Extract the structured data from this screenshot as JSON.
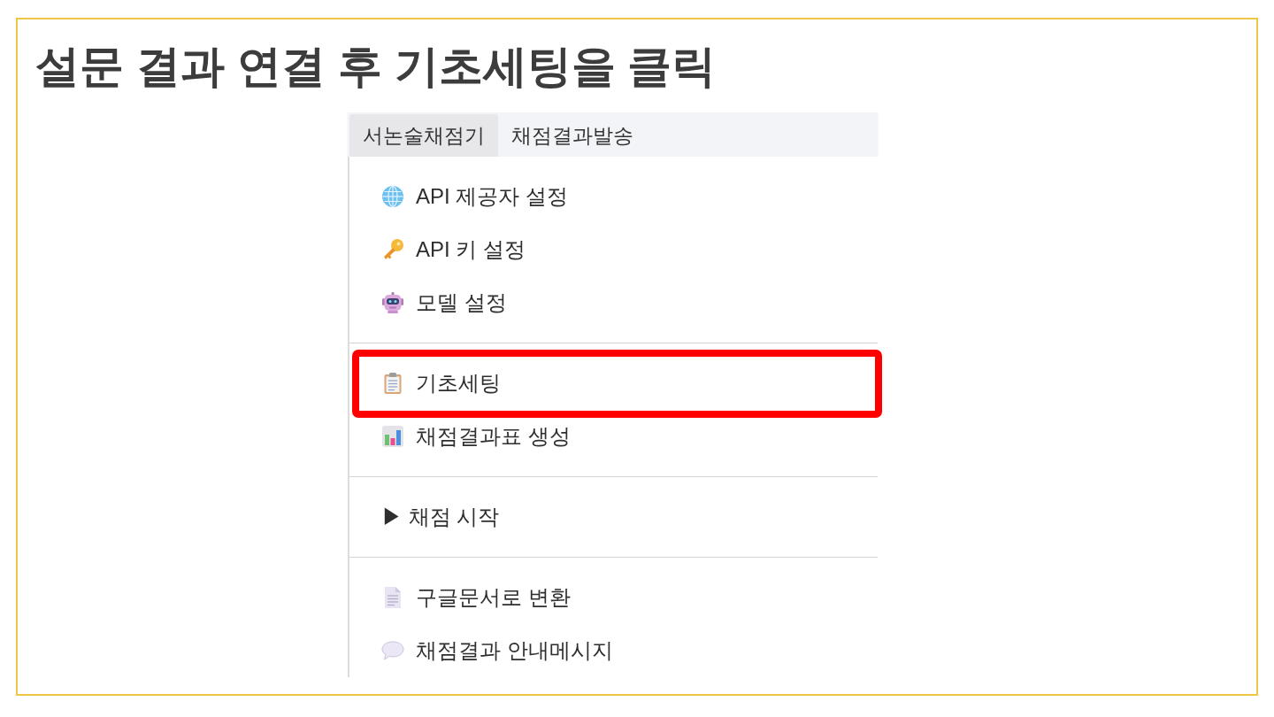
{
  "slide": {
    "title": "설문 결과 연결 후 기초세팅을 클릭"
  },
  "app": {
    "menu_bar": {
      "tabs": [
        {
          "label": "서논술채점기",
          "selected": true
        },
        {
          "label": "채점결과발송",
          "selected": false
        }
      ]
    },
    "dropdown": {
      "groups": [
        {
          "items": [
            {
              "label": "API 제공자 설정",
              "highlighted": false
            },
            {
              "label": "API 키 설정",
              "highlighted": false
            },
            {
              "label": "모델 설정",
              "highlighted": false
            }
          ]
        },
        {
          "items": [
            {
              "label": "기초세팅",
              "highlighted": true
            },
            {
              "label": "채점결과표 생성",
              "highlighted": false
            }
          ]
        },
        {
          "items": [
            {
              "label": "▶ 채점 시작",
              "highlighted": false
            }
          ]
        },
        {
          "items": [
            {
              "label": "구글문서로 변환",
              "highlighted": false
            },
            {
              "label": "채점결과 안내메시지",
              "highlighted": false
            }
          ]
        }
      ]
    }
  }
}
